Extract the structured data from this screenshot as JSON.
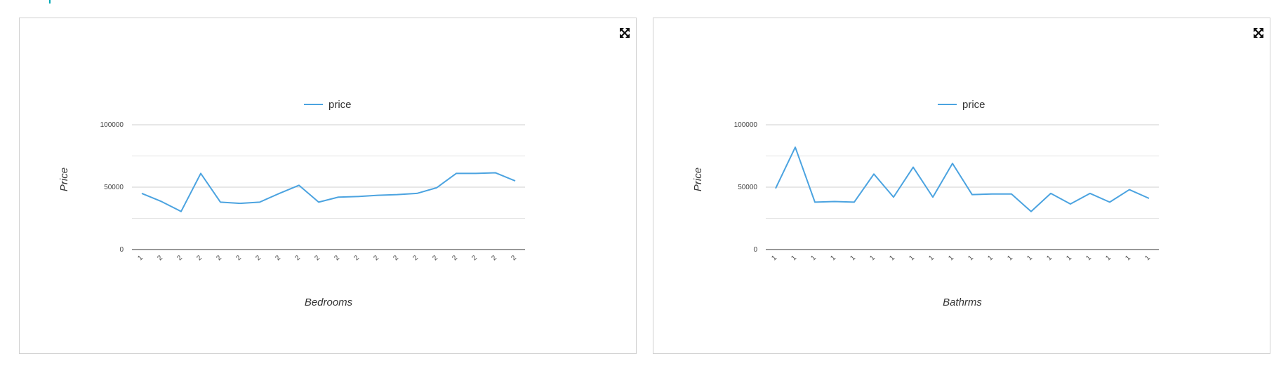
{
  "icons": {
    "expand": "expand-arrows-icon"
  },
  "colors": {
    "line": "#4ba3e0",
    "grid": "#e3e3e3",
    "axis": "#333333"
  },
  "chart_data": [
    {
      "type": "line",
      "legend": "price",
      "legend_position": "top",
      "xlabel": "Bedrooms",
      "ylabel": "Price",
      "ylim": [
        0,
        100000
      ],
      "yticks": [
        0,
        50000,
        100000
      ],
      "ytick_labels": [
        "0",
        "50000",
        "100000"
      ],
      "grid": true,
      "categories": [
        "1",
        "2",
        "2",
        "2",
        "2",
        "2",
        "2",
        "2",
        "2",
        "2",
        "2",
        "2",
        "2",
        "2",
        "2",
        "2",
        "2",
        "2",
        "2",
        "2"
      ],
      "series": [
        {
          "name": "price",
          "values": [
            45000,
            38500,
            30500,
            61000,
            38000,
            37000,
            38000,
            45000,
            51500,
            38000,
            42000,
            42500,
            43500,
            44000,
            45000,
            49500,
            61000,
            61000,
            61500,
            55000
          ]
        }
      ]
    },
    {
      "type": "line",
      "legend": "price",
      "legend_position": "top",
      "xlabel": "Bathrms",
      "ylabel": "Price",
      "ylim": [
        0,
        100000
      ],
      "yticks": [
        0,
        50000,
        100000
      ],
      "ytick_labels": [
        "0",
        "50000",
        "100000"
      ],
      "grid": true,
      "categories": [
        "1",
        "1",
        "1",
        "1",
        "1",
        "1",
        "1",
        "1",
        "1",
        "1",
        "1",
        "1",
        "1",
        "1",
        "1",
        "1",
        "1",
        "1",
        "1",
        "1"
      ],
      "series": [
        {
          "name": "price",
          "values": [
            49000,
            82000,
            38000,
            38500,
            38000,
            60500,
            42000,
            66000,
            42000,
            69000,
            44000,
            44500,
            44500,
            30500,
            45000,
            36500,
            45000,
            38000,
            48000,
            41000
          ]
        }
      ]
    }
  ]
}
